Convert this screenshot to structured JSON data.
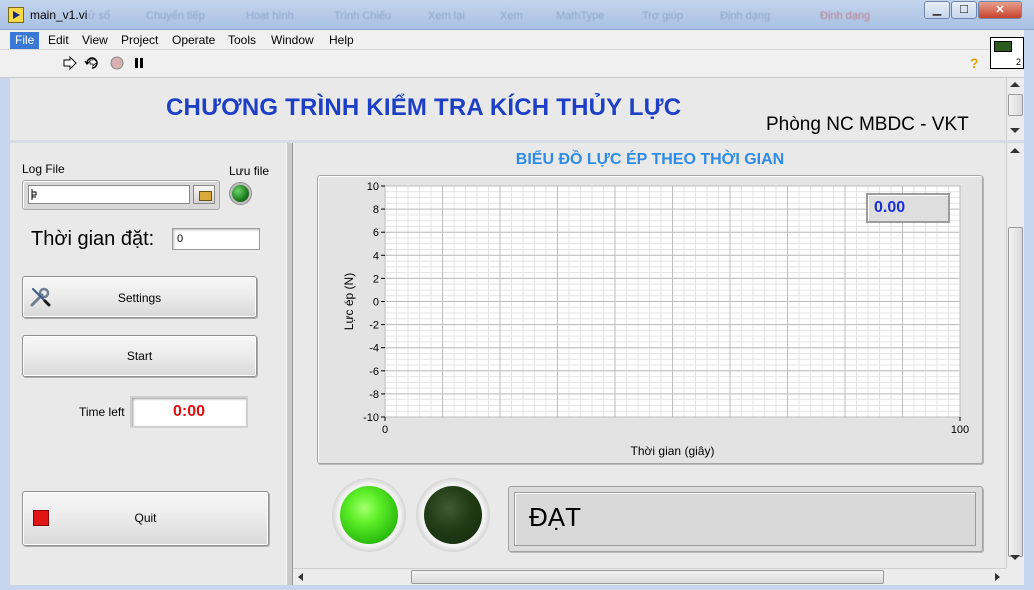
{
  "window": {
    "title": "main_v1.vi",
    "blurred_taskbar": [
      "ử sổ",
      "Chuyển tiếp",
      "Hoạt hình",
      "Trình Chiếu",
      "Xem lại",
      "Xem",
      "MathType",
      "Trợ giúp",
      "Định dạng",
      "Định dạng"
    ],
    "minimize": "▁",
    "maximize": "☐",
    "close": "✕"
  },
  "menu": {
    "items": [
      "File",
      "Edit",
      "View",
      "Project",
      "Operate",
      "Tools",
      "Window",
      "Help"
    ]
  },
  "toolbar": {
    "run_icon": "run-arrow-icon",
    "run_continuous_icon": "run-continuously-icon",
    "abort_icon": "abort-icon",
    "pause_icon": "pause-icon",
    "help_icon": "?",
    "vi_icon_number": "2"
  },
  "header": {
    "title": "CHƯƠNG TRÌNH KIỂM TRA KÍCH THỦY LỰC",
    "organization": "Phòng NC MBDC - VKT"
  },
  "controls": {
    "log_file_label": "Log File",
    "log_file_value": "",
    "log_file_path_icon": "path-icon",
    "luu_file_label": "Lưu file",
    "luu_file_led_on": true,
    "thoi_gian_label": "Thời gian đặt:",
    "thoi_gian_value": "0",
    "settings_label": "Settings",
    "start_label": "Start",
    "time_left_label": "Time left",
    "time_left_value": "0:00",
    "quit_label": "Quit"
  },
  "chart": {
    "title": "BIỂU ĐỒ LỰC ÉP THEO THỜI GIAN",
    "readout": "0.00"
  },
  "chart_data": {
    "type": "line",
    "title": "BIỂU ĐỒ LỰC ÉP THEO THỜI GIAN",
    "xlabel": "Thời gian (giây)",
    "ylabel": "Lực ép (N)",
    "xlim": [
      0,
      100
    ],
    "ylim": [
      -10,
      10
    ],
    "x_ticks": [
      "0",
      "100"
    ],
    "y_ticks": [
      "10",
      "8",
      "6",
      "4",
      "2",
      "0",
      "-2",
      "-4",
      "-6",
      "-8",
      "-10"
    ],
    "grid": true,
    "series": []
  },
  "indicators": {
    "lamp_pass_on": true,
    "lamp_fail_on": false,
    "result_text": "ĐẠT"
  },
  "colors": {
    "title_blue": "#1c3fc5",
    "chart_title_blue": "#2f8be8",
    "time_left_red": "#e01010",
    "readout_blue": "#1a2fd8",
    "lamp_green": "#5ff02a"
  }
}
